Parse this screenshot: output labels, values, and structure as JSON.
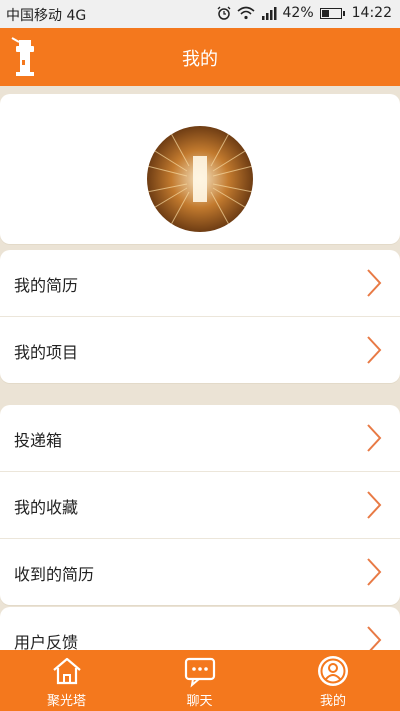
{
  "status_bar": {
    "carrier": "中国移动 4G",
    "battery_percent": "42%",
    "battery_level": 0.42,
    "time": "14:22",
    "icons": [
      "alarm-icon",
      "wifi-icon",
      "signal-icon",
      "battery-icon"
    ]
  },
  "header": {
    "title": "我的",
    "logo": "lighthouse-logo-icon"
  },
  "profile": {
    "avatar": "avatar"
  },
  "menu_groups": [
    {
      "items": [
        {
          "label": "我的简历"
        },
        {
          "label": "我的项目"
        }
      ]
    },
    {
      "items": [
        {
          "label": "投递箱"
        },
        {
          "label": "我的收藏"
        },
        {
          "label": "收到的简历"
        }
      ]
    },
    {
      "items": [
        {
          "label": "用户反馈"
        }
      ]
    }
  ],
  "tabs": [
    {
      "label": "聚光塔",
      "icon": "home-icon"
    },
    {
      "label": "聊天",
      "icon": "chat-icon"
    },
    {
      "label": "我的",
      "icon": "profile-icon"
    }
  ],
  "colors": {
    "accent": "#f4781d",
    "background": "#ebe3d5",
    "chevron": "#e87a45"
  }
}
